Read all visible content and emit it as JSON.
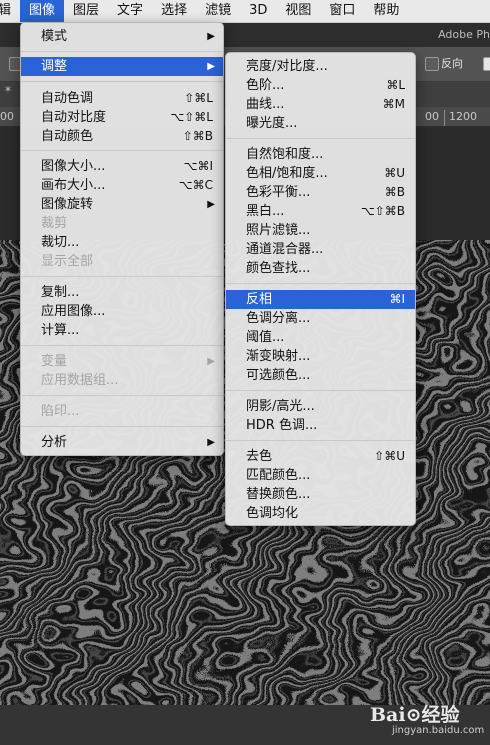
{
  "menubar": {
    "items": [
      "辑",
      "图像",
      "图层",
      "文字",
      "选择",
      "滤镜",
      "3D",
      "视图",
      "窗口",
      "帮助"
    ]
  },
  "app": {
    "title": "Adobe Ph"
  },
  "options_bar": {
    "reverse_label": "反向"
  },
  "tab": {
    "marker": "*"
  },
  "ruler": {
    "labels": [
      "00",
      "00",
      "1200"
    ]
  },
  "image_menu": {
    "items": [
      {
        "label": "模式",
        "shortcut": "",
        "submenu": true,
        "enabled": true
      },
      {
        "label": "调整",
        "shortcut": "",
        "submenu": true,
        "enabled": true,
        "highlighted": true
      },
      {
        "label": "自动色调",
        "shortcut": "⇧⌘L",
        "submenu": false,
        "enabled": true
      },
      {
        "label": "自动对比度",
        "shortcut": "⌥⇧⌘L",
        "submenu": false,
        "enabled": true
      },
      {
        "label": "自动颜色",
        "shortcut": "⇧⌘B",
        "submenu": false,
        "enabled": true
      },
      {
        "label": "图像大小...",
        "shortcut": "⌥⌘I",
        "submenu": false,
        "enabled": true
      },
      {
        "label": "画布大小...",
        "shortcut": "⌥⌘C",
        "submenu": false,
        "enabled": true
      },
      {
        "label": "图像旋转",
        "shortcut": "",
        "submenu": true,
        "enabled": true
      },
      {
        "label": "裁剪",
        "shortcut": "",
        "submenu": false,
        "enabled": false
      },
      {
        "label": "裁切...",
        "shortcut": "",
        "submenu": false,
        "enabled": true
      },
      {
        "label": "显示全部",
        "shortcut": "",
        "submenu": false,
        "enabled": false
      },
      {
        "label": "复制...",
        "shortcut": "",
        "submenu": false,
        "enabled": true
      },
      {
        "label": "应用图像...",
        "shortcut": "",
        "submenu": false,
        "enabled": true
      },
      {
        "label": "计算...",
        "shortcut": "",
        "submenu": false,
        "enabled": true
      },
      {
        "label": "变量",
        "shortcut": "",
        "submenu": true,
        "enabled": false
      },
      {
        "label": "应用数据组...",
        "shortcut": "",
        "submenu": false,
        "enabled": false
      },
      {
        "label": "陷印...",
        "shortcut": "",
        "submenu": false,
        "enabled": false
      },
      {
        "label": "分析",
        "shortcut": "",
        "submenu": true,
        "enabled": true
      }
    ]
  },
  "adjust_menu": {
    "items": [
      {
        "label": "亮度/对比度...",
        "shortcut": ""
      },
      {
        "label": "色阶...",
        "shortcut": "⌘L"
      },
      {
        "label": "曲线...",
        "shortcut": "⌘M"
      },
      {
        "label": "曝光度...",
        "shortcut": ""
      },
      {
        "label": "自然饱和度...",
        "shortcut": ""
      },
      {
        "label": "色相/饱和度...",
        "shortcut": "⌘U"
      },
      {
        "label": "色彩平衡...",
        "shortcut": "⌘B"
      },
      {
        "label": "黑白...",
        "shortcut": "⌥⇧⌘B"
      },
      {
        "label": "照片滤镜...",
        "shortcut": ""
      },
      {
        "label": "通道混合器...",
        "shortcut": ""
      },
      {
        "label": "颜色查找...",
        "shortcut": ""
      },
      {
        "label": "反相",
        "shortcut": "⌘I",
        "highlighted": true
      },
      {
        "label": "色调分离...",
        "shortcut": ""
      },
      {
        "label": "阈值...",
        "shortcut": ""
      },
      {
        "label": "渐变映射...",
        "shortcut": ""
      },
      {
        "label": "可选颜色...",
        "shortcut": ""
      },
      {
        "label": "阴影/高光...",
        "shortcut": ""
      },
      {
        "label": "HDR 色调...",
        "shortcut": ""
      },
      {
        "label": "去色",
        "shortcut": "⇧⌘U"
      },
      {
        "label": "匹配颜色...",
        "shortcut": ""
      },
      {
        "label": "替换颜色...",
        "shortcut": ""
      },
      {
        "label": "色调均化",
        "shortcut": ""
      }
    ]
  },
  "watermark": {
    "logo": "Bai⊙经验",
    "url": "jingyan.baidu.com"
  },
  "colors": {
    "highlight": "#2a63d6",
    "menu_bg": "#e5e5e5",
    "disabled": "#a4a4a4"
  }
}
